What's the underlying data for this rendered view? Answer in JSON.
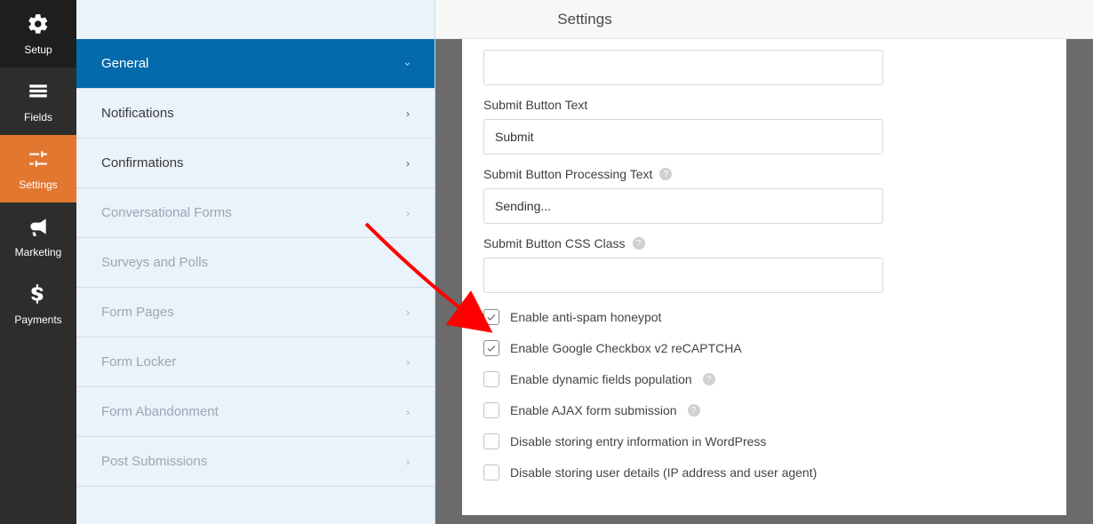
{
  "header": {
    "title": "Settings"
  },
  "mainSidebar": {
    "items": [
      {
        "label": "Setup"
      },
      {
        "label": "Fields"
      },
      {
        "label": "Settings"
      },
      {
        "label": "Marketing"
      },
      {
        "label": "Payments"
      }
    ]
  },
  "settingsPanel": {
    "items": [
      {
        "label": "General",
        "active": true
      },
      {
        "label": "Notifications"
      },
      {
        "label": "Confirmations"
      },
      {
        "label": "Conversational Forms",
        "dimmed": true
      },
      {
        "label": "Surveys and Polls",
        "dimmed": true
      },
      {
        "label": "Form Pages",
        "dimmed": true
      },
      {
        "label": "Form Locker",
        "dimmed": true
      },
      {
        "label": "Form Abandonment",
        "dimmed": true
      },
      {
        "label": "Post Submissions",
        "dimmed": true
      }
    ]
  },
  "form": {
    "topInput": {
      "value": ""
    },
    "submitText": {
      "label": "Submit Button Text",
      "value": "Submit"
    },
    "processingText": {
      "label": "Submit Button Processing Text",
      "value": "Sending..."
    },
    "cssClass": {
      "label": "Submit Button CSS Class",
      "value": ""
    },
    "checks": [
      {
        "label": "Enable anti-spam honeypot",
        "checked": true,
        "help": false
      },
      {
        "label": "Enable Google Checkbox v2 reCAPTCHA",
        "checked": true,
        "help": false
      },
      {
        "label": "Enable dynamic fields population",
        "checked": false,
        "help": true
      },
      {
        "label": "Enable AJAX form submission",
        "checked": false,
        "help": true
      },
      {
        "label": "Disable storing entry information in WordPress",
        "checked": false,
        "help": false
      },
      {
        "label": "Disable storing user details (IP address and user agent)",
        "checked": false,
        "help": false
      }
    ]
  }
}
